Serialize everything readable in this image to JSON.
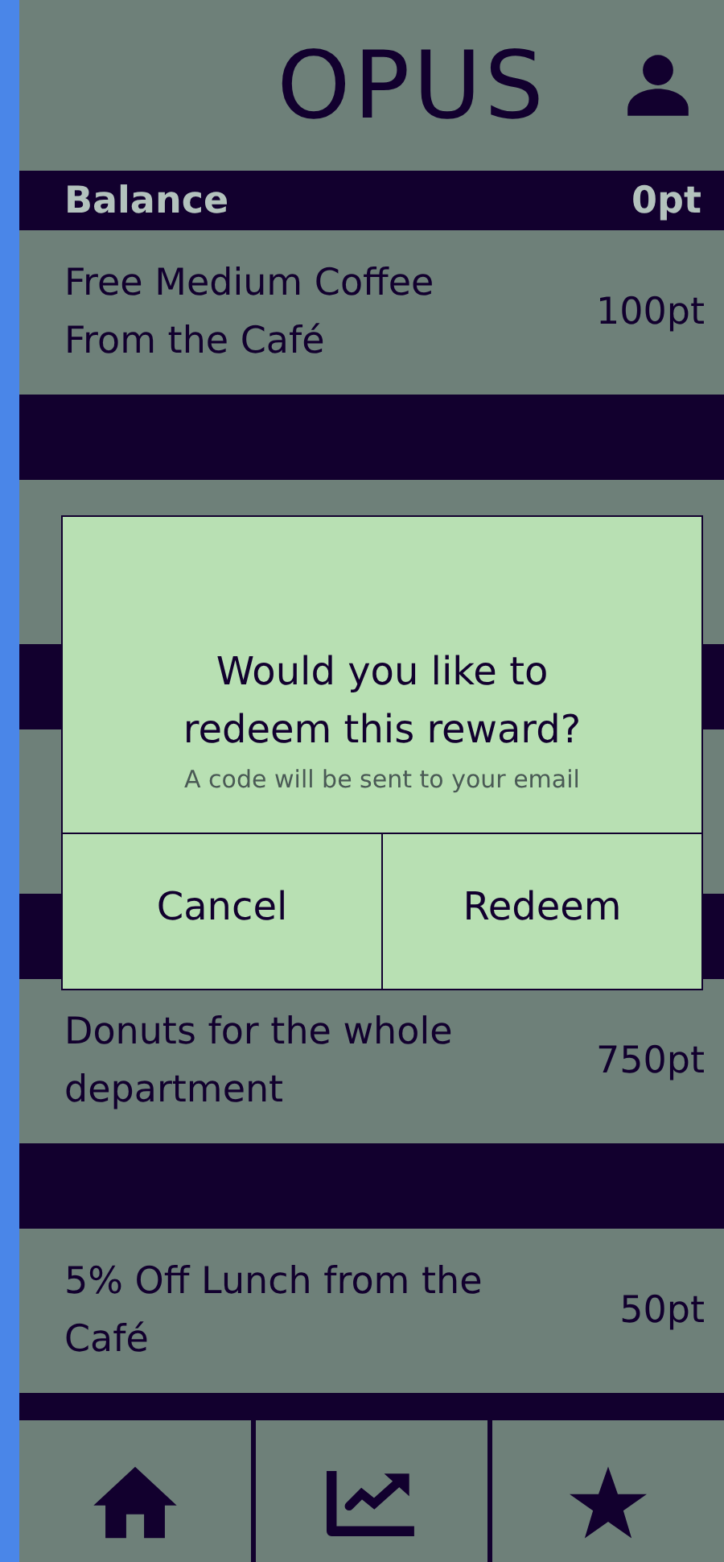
{
  "header": {
    "title": "OPUS"
  },
  "balance": {
    "label": "Balance",
    "value": "0pt"
  },
  "rewards": [
    {
      "kind": "reward",
      "title": "Free Medium Coffee From the Café",
      "points": "100pt"
    },
    {
      "kind": "covered"
    },
    {
      "kind": "covered"
    },
    {
      "kind": "reward",
      "title": "Donuts for the whole department",
      "points": "750pt"
    },
    {
      "kind": "reward",
      "title": "5% Off Lunch from the Café",
      "points": "50pt"
    }
  ],
  "dialog": {
    "title": "Would you like to redeem this reward?",
    "note": "A code will be sent to your email",
    "buttons": [
      "Cancel",
      "Redeem"
    ]
  },
  "nav": [
    {
      "kind": "home"
    },
    {
      "kind": "chart"
    },
    {
      "kind": "star"
    }
  ]
}
